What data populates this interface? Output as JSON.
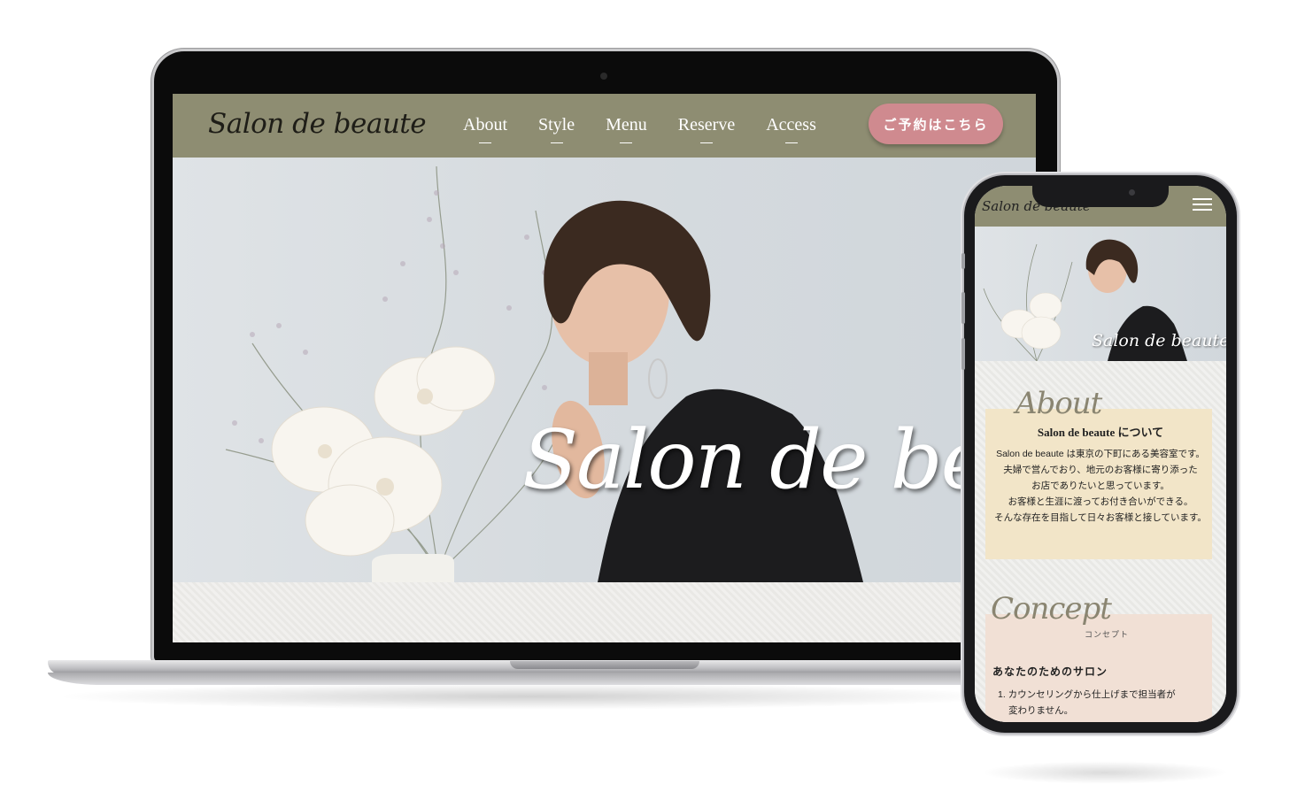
{
  "desktop": {
    "logo": "Salon de beaute",
    "nav": [
      "About",
      "Style",
      "Menu",
      "Reserve",
      "Access"
    ],
    "reserve_button": "ご予約はこちら",
    "hero_title": "Salon de beaute"
  },
  "mobile": {
    "logo": "Salon de beaute",
    "hero_title": "Salon de beaute",
    "about": {
      "heading": "About",
      "title": "Salon de beaute について",
      "lines": [
        "Salon de beaute は東京の下町にある美容室です。",
        "夫婦で営んでおり、地元のお客様に寄り添った",
        "お店でありたいと思っています。",
        "お客様と生涯に渡ってお付き合いができる。",
        "そんな存在を目指して日々お客様と接しています。"
      ]
    },
    "concept": {
      "heading": "Concept",
      "subheading": "コンセプト",
      "title": "あなたのためのサロン",
      "item_1": "1. カウンセリングから仕上げまで担当者が",
      "item_1_cont": "変わりません。"
    }
  },
  "colors": {
    "header": "#8e8d72",
    "button": "#cf8a8f",
    "about_card": "#f2e5c8",
    "concept_card": "#f1e0d5"
  }
}
